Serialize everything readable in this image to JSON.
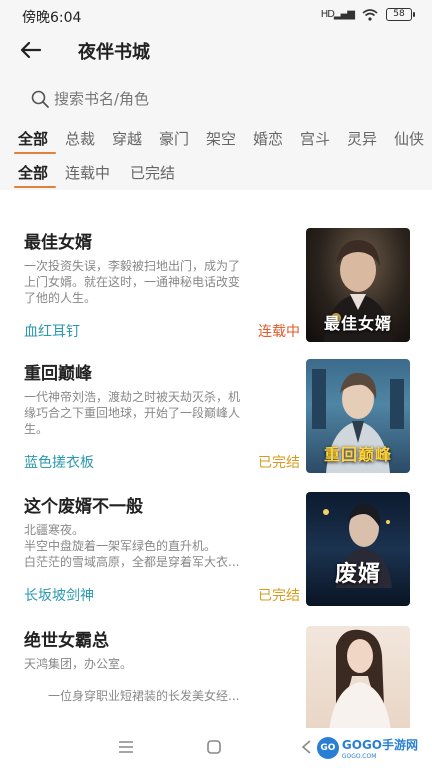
{
  "status_bar": {
    "time": "傍晚6:04",
    "signal": "HD",
    "battery": "58"
  },
  "header": {
    "title": "夜伴书城"
  },
  "search": {
    "placeholder": "搜索书名/角色"
  },
  "categories": [
    "全部",
    "总裁",
    "穿越",
    "豪门",
    "架空",
    "婚恋",
    "宫斗",
    "灵异",
    "仙侠"
  ],
  "status_filters": [
    "全部",
    "连载中",
    "已完结"
  ],
  "colors": {
    "accent": "#e0823a",
    "author": "#2a9ab0",
    "serializing": "#e05a2a",
    "completed": "#d89a1a"
  },
  "books": [
    {
      "name": "最佳女婿",
      "desc": [
        "一次投资失误，李毅被扫地出门，成为了",
        "上门女婿。就在这时，一通神秘电话改变",
        "了他的人生。"
      ],
      "author": "血红耳钉",
      "status": "连载中",
      "cover_title": "最佳女婿"
    },
    {
      "name": "重回巅峰",
      "desc": [
        "一代神帝刘浩，渡劫之时被天劫灭杀，机",
        "缘巧合之下重回地球，开始了一段巅峰人",
        "生。"
      ],
      "author": "蓝色搓衣板",
      "status": "已完结",
      "cover_title": "重回巅峰"
    },
    {
      "name": "这个废婿不一般",
      "desc": [
        "北疆寒夜。",
        "半空中盘旋着一架军绿色的直升机。",
        "白茫茫的雪域高原，全都是穿着军大衣..."
      ],
      "author": "长坂坡剑神",
      "status": "已完结",
      "cover_title": "废婿"
    },
    {
      "name": "绝世女霸总",
      "desc": [
        "天鸿集团，办公室。",
        "",
        "　　一位身穿职业短裙装的长发美女经..."
      ],
      "author": "",
      "status": "",
      "cover_title": ""
    }
  ],
  "watermark": {
    "logo": "GO",
    "text": "GOGO手游网",
    "sub": "GOGO.COM"
  }
}
